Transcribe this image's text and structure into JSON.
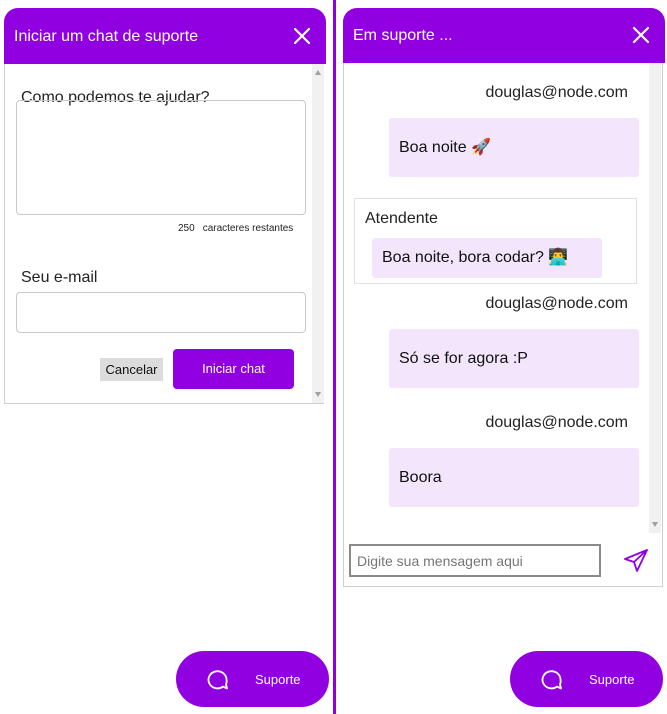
{
  "support_form": {
    "title": "Iniciar um chat de suporte",
    "help_label": "Como podemos te ajudar?",
    "help_value": "",
    "chars_remaining": "250",
    "chars_label": "caracteres restantes",
    "email_label": "Seu e-mail",
    "email_value": "",
    "cancel_label": "Cancelar",
    "start_label": "Iniciar chat"
  },
  "chat": {
    "title": "Em suporte ...",
    "messages": [
      {
        "sender": "douglas@node.com",
        "text": "Boa noite 🚀"
      },
      {
        "sender": "Atendente",
        "text": "Boa noite, bora codar? 👨‍💻"
      },
      {
        "sender": "douglas@node.com",
        "text": "Só se for agora :P"
      },
      {
        "sender": "douglas@node.com",
        "text": "Boora"
      }
    ],
    "input_placeholder": "Digite sua mensagem aqui"
  },
  "fab": {
    "label": "Suporte"
  },
  "colors": {
    "accent": "#9000e0",
    "bubble": "#f3e5fb"
  },
  "icons": {
    "close": "close-icon",
    "send": "send-icon",
    "chat": "chat-bubble-icon"
  }
}
